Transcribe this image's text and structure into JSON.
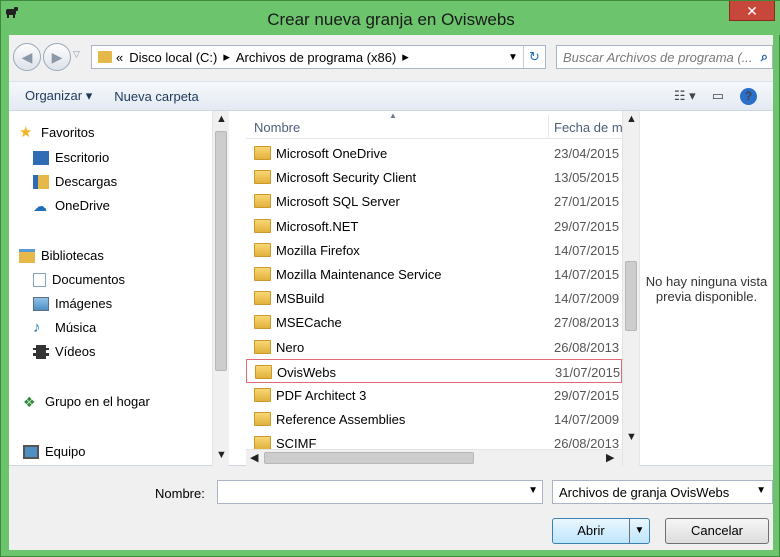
{
  "window": {
    "title": "Crear nueva granja en Oviswebs",
    "close_label": "✕"
  },
  "address": {
    "chevrons": "«",
    "segments": [
      "Disco local (C:)",
      "Archivos de programa (x86)"
    ],
    "search_placeholder": "Buscar Archivos de programa (..."
  },
  "toolbar": {
    "organize": "Organizar ▾",
    "new_folder": "Nueva carpeta"
  },
  "nav": {
    "favorites": "Favoritos",
    "fav_items": [
      "Escritorio",
      "Descargas",
      "OneDrive"
    ],
    "libraries": "Bibliotecas",
    "lib_items": [
      "Documentos",
      "Imágenes",
      "Música",
      "Vídeos"
    ],
    "homegroup": "Grupo en el hogar",
    "computer": "Equipo"
  },
  "files": {
    "col_name": "Nombre",
    "col_date": "Fecha de modificación",
    "rows": [
      {
        "name": "Microsoft OneDrive",
        "date": "23/04/2015"
      },
      {
        "name": "Microsoft Security Client",
        "date": "13/05/2015"
      },
      {
        "name": "Microsoft SQL Server",
        "date": "27/01/2015"
      },
      {
        "name": "Microsoft.NET",
        "date": "29/07/2015"
      },
      {
        "name": "Mozilla Firefox",
        "date": "14/07/2015"
      },
      {
        "name": "Mozilla Maintenance Service",
        "date": "14/07/2015"
      },
      {
        "name": "MSBuild",
        "date": "14/07/2009"
      },
      {
        "name": "MSECache",
        "date": "27/08/2013"
      },
      {
        "name": "Nero",
        "date": "26/08/2013"
      },
      {
        "name": "OvisWebs",
        "date": "31/07/2015"
      },
      {
        "name": "PDF Architect 3",
        "date": "29/07/2015"
      },
      {
        "name": "Reference Assemblies",
        "date": "14/07/2009"
      },
      {
        "name": "SCIMF",
        "date": "26/08/2013"
      }
    ],
    "selected_row": "OvisWebs"
  },
  "preview": {
    "text": "No hay ninguna vista previa disponible."
  },
  "bottom": {
    "name_label": "Nombre:",
    "name_value": "",
    "filter": "Archivos de granja OvisWebs",
    "open": "Abrir",
    "cancel": "Cancelar"
  },
  "colors": {
    "titlebar": "#6cc46c",
    "close": "#c7473a",
    "selection_border": "#e06a76",
    "folder": "#e6b84a"
  }
}
